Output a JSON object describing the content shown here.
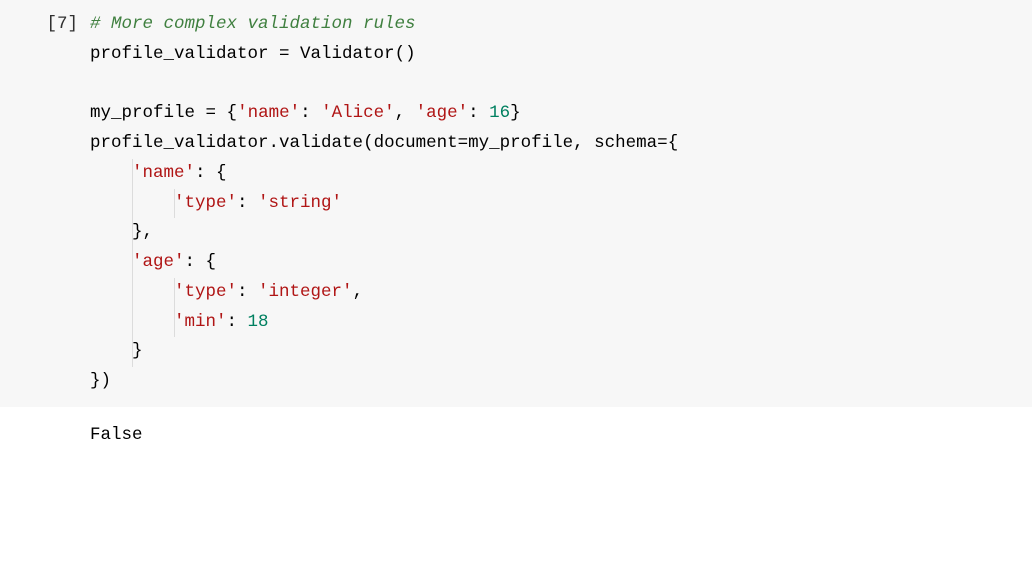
{
  "cell": {
    "prompt": "[7]",
    "code": {
      "l1_comment": "# More complex validation rules",
      "l2_var": "profile_validator",
      "l2_eq": " = ",
      "l2_call": "Validator",
      "l2_paren": "()",
      "l4_var": "my_profile",
      "l4_eq": " = ",
      "l4_open": "{",
      "l4_k1": "'name'",
      "l4_colon1": ": ",
      "l4_v1": "'Alice'",
      "l4_comma": ", ",
      "l4_k2": "'age'",
      "l4_colon2": ": ",
      "l4_v2": "16",
      "l4_close": "}",
      "l5_obj": "profile_validator",
      "l5_dot": ".",
      "l5_method": "validate",
      "l5_open": "(",
      "l5_arg1": "document",
      "l5_eqb": "=",
      "l5_arg1v": "my_profile",
      "l5_comma": ", ",
      "l5_arg2": "schema",
      "l5_eqc": "=",
      "l5_brace": "{",
      "l6_indent": "    ",
      "l6_key": "'name'",
      "l6_colon": ": {",
      "l7_indent": "        ",
      "l7_key": "'type'",
      "l7_colon": ": ",
      "l7_val": "'string'",
      "l8_indent": "    ",
      "l8_close": "},",
      "l9_indent": "    ",
      "l9_key": "'age'",
      "l9_colon": ": {",
      "l10_indent": "        ",
      "l10_key": "'type'",
      "l10_colon": ": ",
      "l10_val": "'integer'",
      "l10_comma": ",",
      "l11_indent": "        ",
      "l11_key": "'min'",
      "l11_colon": ": ",
      "l11_val": "18",
      "l12_indent": "    ",
      "l12_close": "}",
      "l13_close": "})"
    },
    "output": "False"
  }
}
